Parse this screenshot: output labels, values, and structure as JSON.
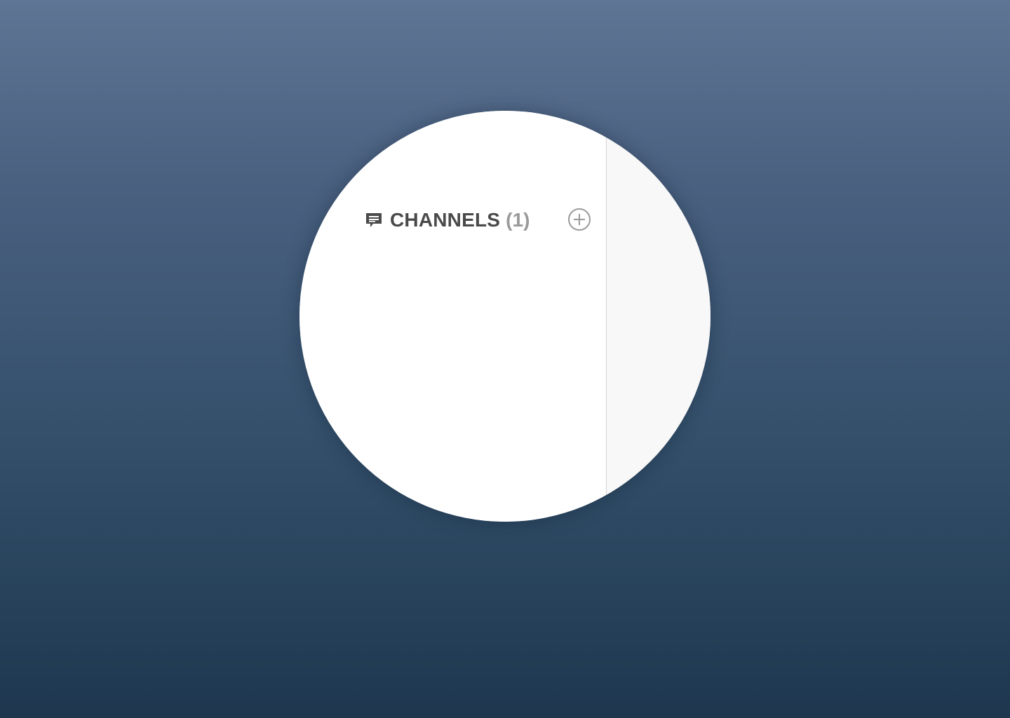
{
  "sidebar": {
    "channels": {
      "icon": "chat-bubble-icon",
      "title": "CHANNELS",
      "count_label": "(1)",
      "add_icon": "plus-circle-icon"
    }
  },
  "colors": {
    "background_top": "#5e7594",
    "background_bottom": "#1e374f",
    "sidebar_bg": "#ffffff",
    "content_bg": "#f8f8f8",
    "title_text": "#4a4a4a",
    "count_text": "#9a9a9a",
    "icon_gray": "#4a4a4a",
    "add_icon_gray": "#9a9a9a"
  }
}
